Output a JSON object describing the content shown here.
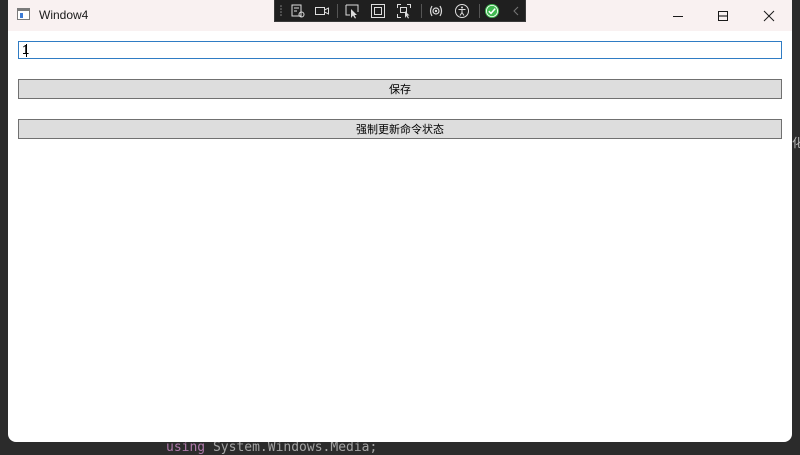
{
  "window": {
    "title": "Window4",
    "controls": {
      "minimize": "minimize-icon",
      "maximize": "maximize-icon",
      "close": "close-icon"
    }
  },
  "debug_toolbar": {
    "icons": [
      "gripper-icon",
      "live-visual-tree-icon",
      "camera-icon",
      "select-element-icon",
      "display-layout-adorners-icon",
      "track-focus-icon",
      "binding-failures-icon",
      "accessibility-icon",
      "hot-reload-ok-icon",
      "collapse-icon"
    ]
  },
  "form": {
    "input_value": "1",
    "save_label": "保存",
    "refresh_label": "强制更新命令状态"
  },
  "background": {
    "code_keyword": "using",
    "code_rest": " System.Windows.Media;",
    "edge_text": "化"
  },
  "colors": {
    "input_border": "#2f7cc4",
    "button_bg": "#dddddd",
    "titlebar_bg": "#f9f1f1",
    "hot_reload_ok": "#3fb950"
  }
}
